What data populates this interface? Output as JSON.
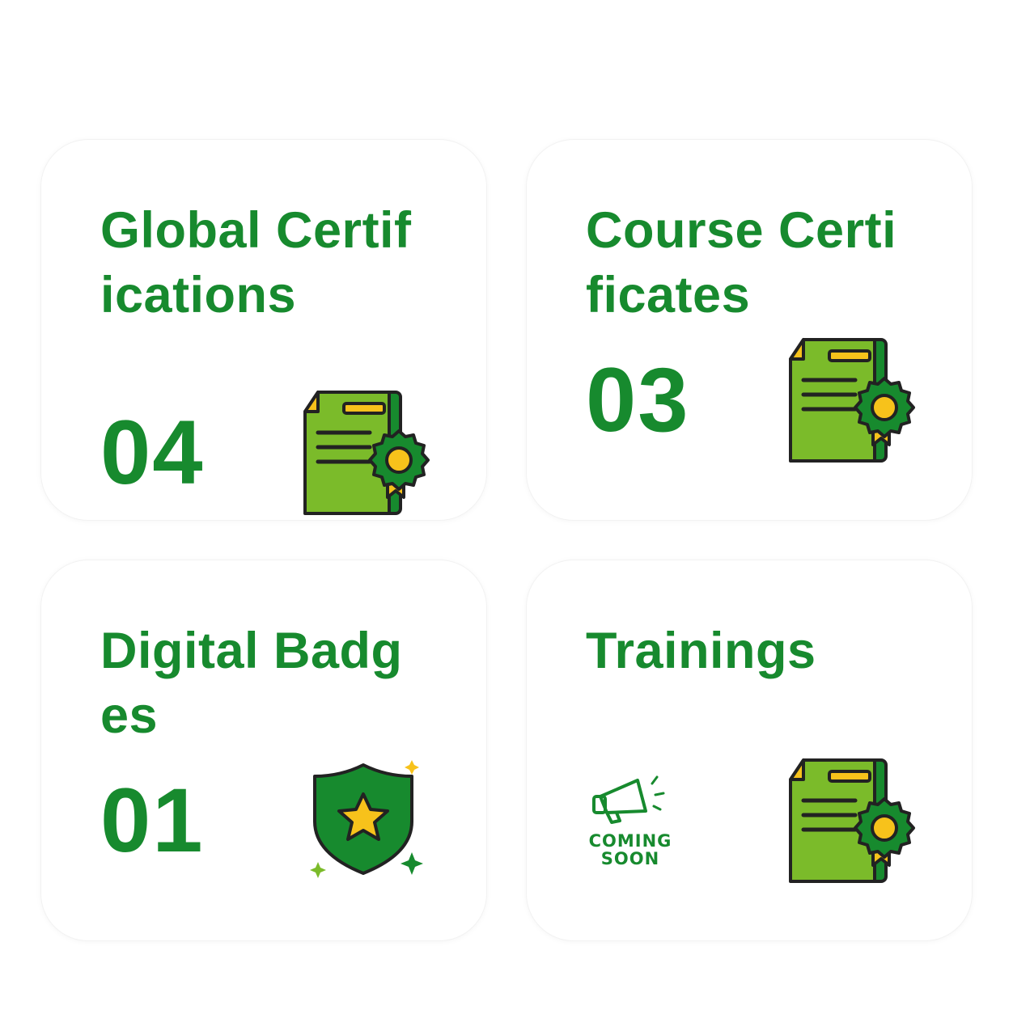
{
  "cards": [
    {
      "title": "Global Certifications",
      "count": "04",
      "icon": "certificate-icon"
    },
    {
      "title": "Course Certificates",
      "count": "03",
      "icon": "certificate-icon"
    },
    {
      "title": "Digital Badges",
      "count": "01",
      "icon": "shield-star-icon"
    },
    {
      "title": "Trainings",
      "icon": "certificate-icon",
      "coming_soon": {
        "line1": "COMING",
        "line2": "SOON",
        "icon": "megaphone-icon"
      }
    }
  ],
  "colors": {
    "brand_green": "#178a2e",
    "light_green": "#7bbb2a",
    "gold": "#f7c21b",
    "dark_outline": "#222222"
  }
}
